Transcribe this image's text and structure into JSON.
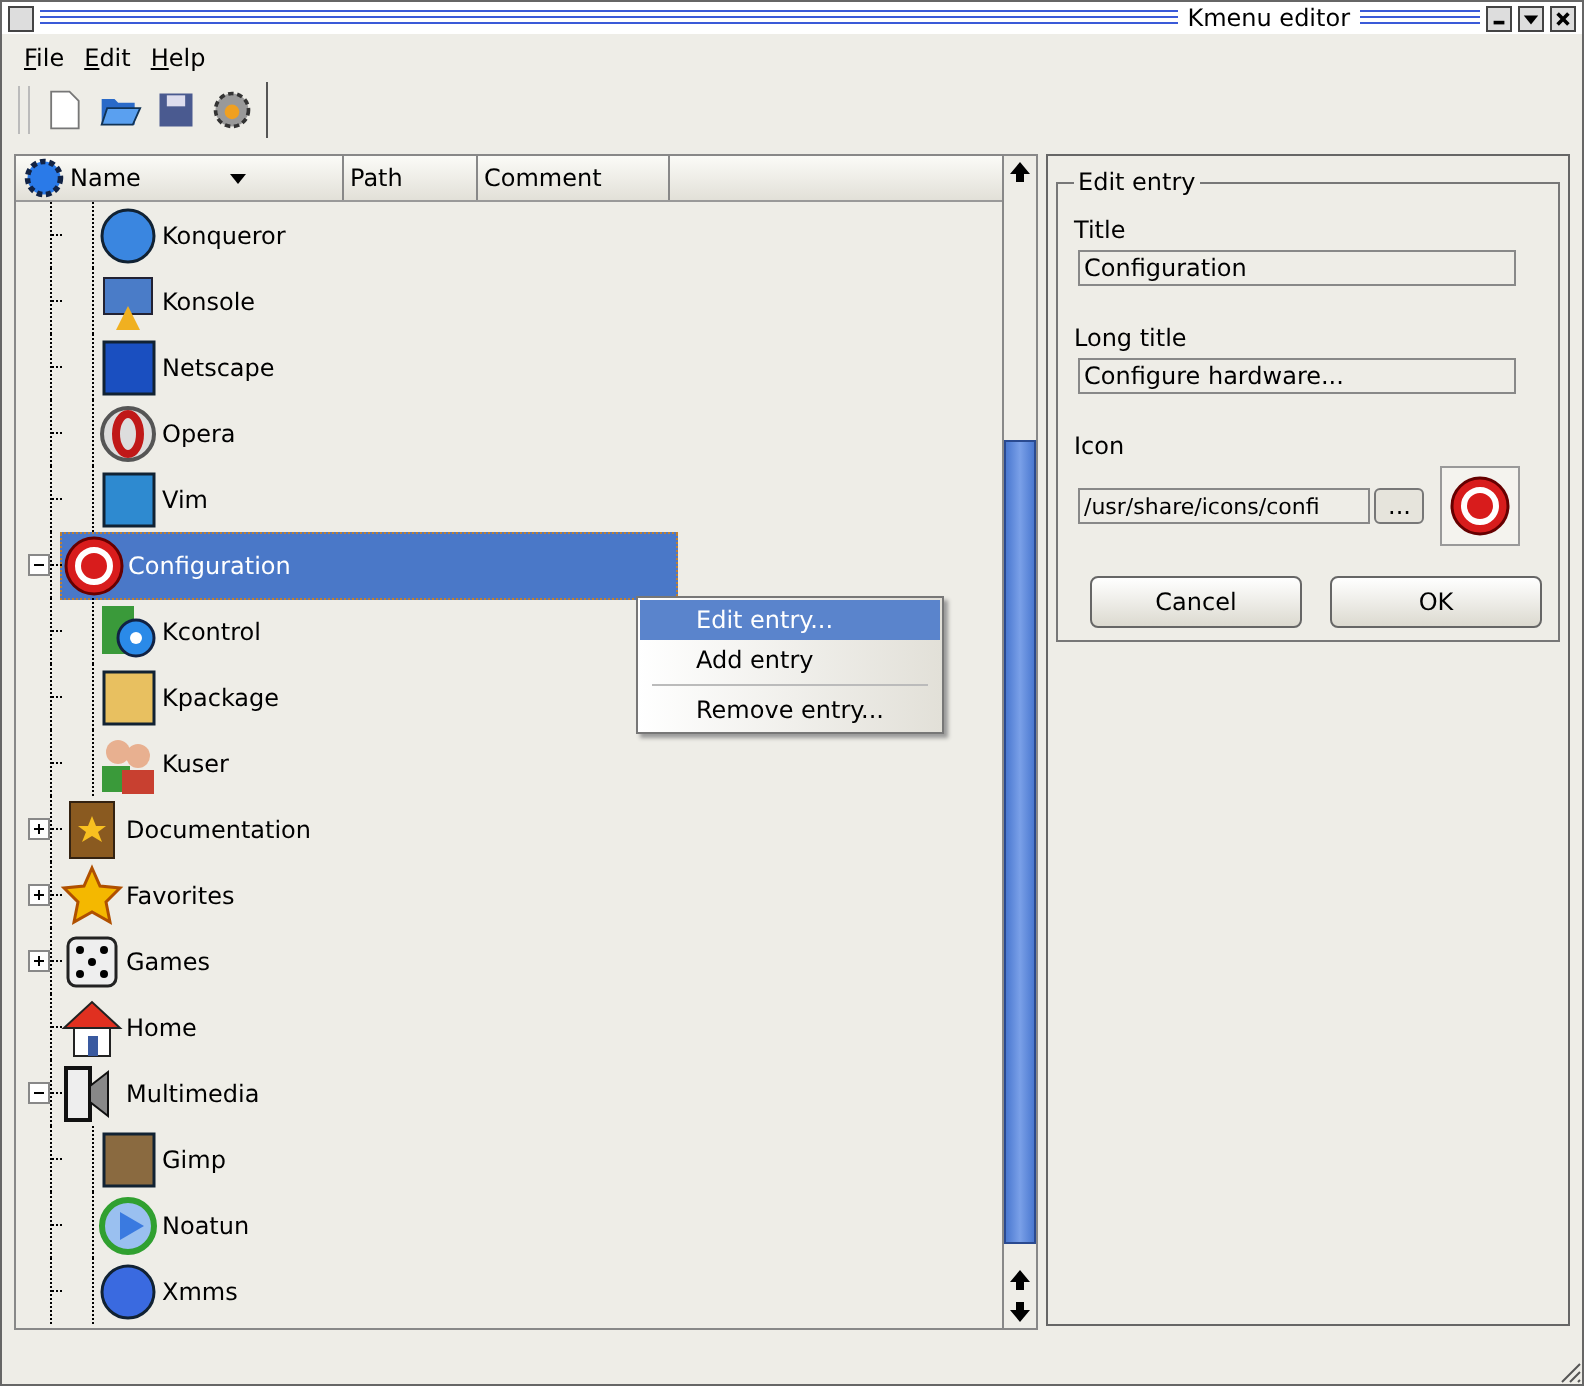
{
  "window": {
    "title": "Kmenu editor"
  },
  "menu_bar": [
    "File",
    "Edit",
    "Help"
  ],
  "tree": {
    "columns": [
      "Name",
      "Path",
      "Comment"
    ],
    "items": [
      {
        "children": [
          {
            "label": "Konqueror",
            "selected": false
          },
          {
            "label": "Konsole",
            "selected": false
          },
          {
            "label": "Netscape",
            "selected": false
          },
          {
            "label": "Opera",
            "selected": false
          },
          {
            "label": "Vim",
            "selected": false
          }
        ]
      },
      {
        "label": "Configuration",
        "selected": true,
        "expanded": true,
        "children": [
          {
            "label": "Kcontrol",
            "selected": false
          },
          {
            "label": "Kpackage",
            "selected": false
          },
          {
            "label": "Kuser",
            "selected": false
          }
        ]
      },
      {
        "label": "Documentation",
        "selected": false,
        "expanded": false
      },
      {
        "label": "Favorites",
        "selected": false,
        "expanded": false
      },
      {
        "label": "Games",
        "selected": false,
        "expanded": false
      },
      {
        "label": "Home",
        "selected": false
      },
      {
        "label": "Multimedia",
        "selected": false,
        "expanded": true,
        "children": [
          {
            "label": "Gimp",
            "selected": false
          },
          {
            "label": "Noatun",
            "selected": false
          },
          {
            "label": "Xmms",
            "selected": false
          }
        ]
      }
    ]
  },
  "context_menu": [
    {
      "label": "Edit entry...",
      "selected": true
    },
    {
      "label": "Add entry",
      "selected": false
    },
    {
      "kind": "separator"
    },
    {
      "label": "Remove entry...",
      "selected": false
    }
  ],
  "edit_panel": {
    "title": "Edit entry",
    "title_label": "Title",
    "title_value": "Configuration",
    "long_title_label": "Long title",
    "long_title_value": "Configure hardware...",
    "icon_label": "Icon",
    "icon_value": "/usr/share/icons/confi",
    "browse_button": "...",
    "buttons": [
      "Cancel",
      "OK"
    ]
  }
}
